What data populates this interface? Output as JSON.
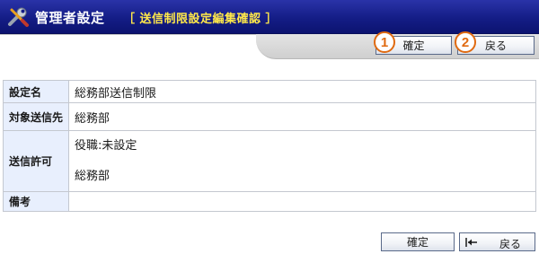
{
  "header": {
    "title": "管理者設定",
    "subtitle": "［ 送信制限設定編集確認 ］",
    "icon": "tools-icon"
  },
  "toolbar": {
    "confirm_label": "確定",
    "back_label": "戻る",
    "badge_1": "1",
    "badge_2": "2"
  },
  "detail": {
    "rows": [
      {
        "label": "設定名",
        "value": "総務部送信制限"
      },
      {
        "label": "対象送信先",
        "value": "総務部"
      },
      {
        "label": "送信許可",
        "value_line1": "役職:未設定",
        "value_line2": "総務部"
      },
      {
        "label": "備考",
        "value": ""
      }
    ]
  },
  "footer": {
    "confirm_label": "確定",
    "back_label": "戻る",
    "back_icon": "back-arrow-icon"
  },
  "colors": {
    "titlebar": "#141d86",
    "subtitle": "#ffe84a",
    "label_bg": "#e8effd",
    "badge": "#e06a10"
  }
}
